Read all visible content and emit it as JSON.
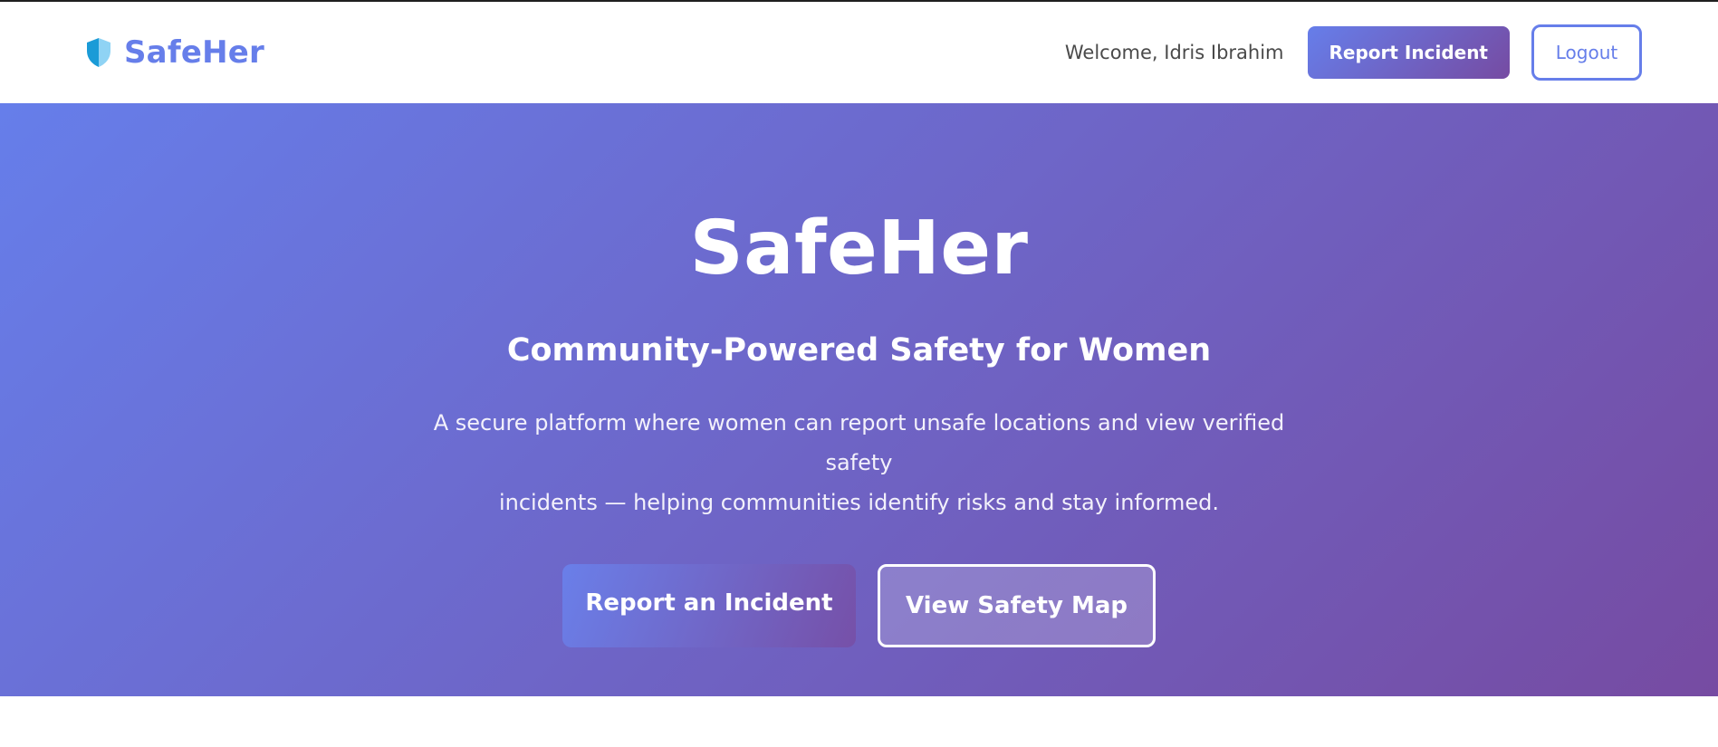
{
  "navbar": {
    "brand_name": "SafeHer",
    "brand_icon": "shield-icon",
    "welcome_text": "Welcome, Idris Ibrahim",
    "report_label": "Report Incident",
    "logout_label": "Logout"
  },
  "hero": {
    "title": "SafeHer",
    "subtitle": "Community-Powered Safety for Women",
    "description_line1": "A secure platform where women can report unsafe locations and view verified safety",
    "description_line2": "incidents — helping communities identify risks and stay informed.",
    "primary_button": "Report an Incident",
    "secondary_button": "View Safety Map"
  },
  "colors": {
    "brand": "#667eea",
    "gradient_start": "#667eea",
    "gradient_end": "#764ba2",
    "shield_dark": "#1a9bd7",
    "shield_light": "#8fd3f4"
  }
}
